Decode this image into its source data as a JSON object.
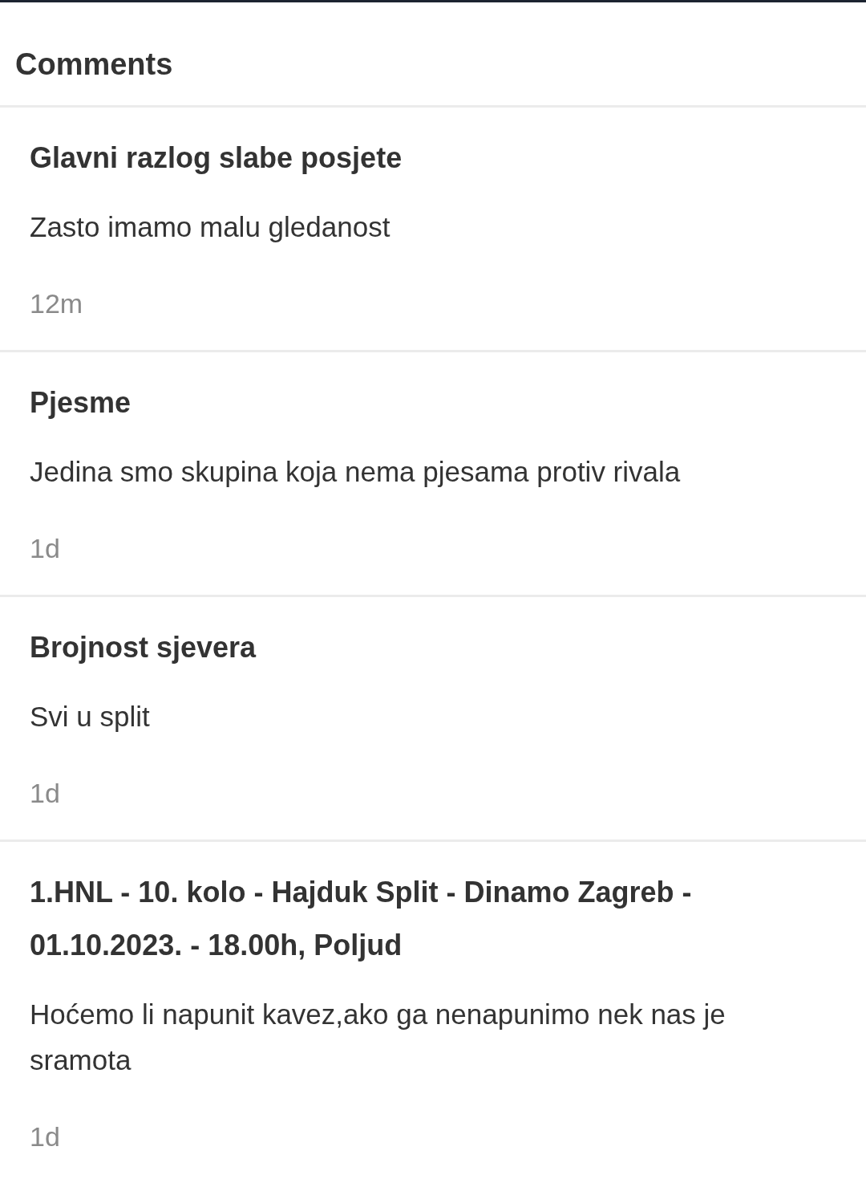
{
  "header": {
    "title": "Comments"
  },
  "comments": [
    {
      "title": "Glavni razlog slabe posjete",
      "body": "Zasto imamo malu gledanost",
      "time": "12m"
    },
    {
      "title": "Pjesme",
      "body": "Jedina smo skupina koja nema pjesama protiv rivala",
      "time": "1d"
    },
    {
      "title": "Brojnost sjevera",
      "body": "Svi u split",
      "time": "1d"
    },
    {
      "title": "1.HNL - 10. kolo - Hajduk Split - Dinamo Zagreb - 01.10.2023. - 18.00h, Poljud",
      "body": "Hoćemo li napunit kavez,ako ga nenapunimo nek nas je sramota",
      "time": "1d"
    }
  ]
}
